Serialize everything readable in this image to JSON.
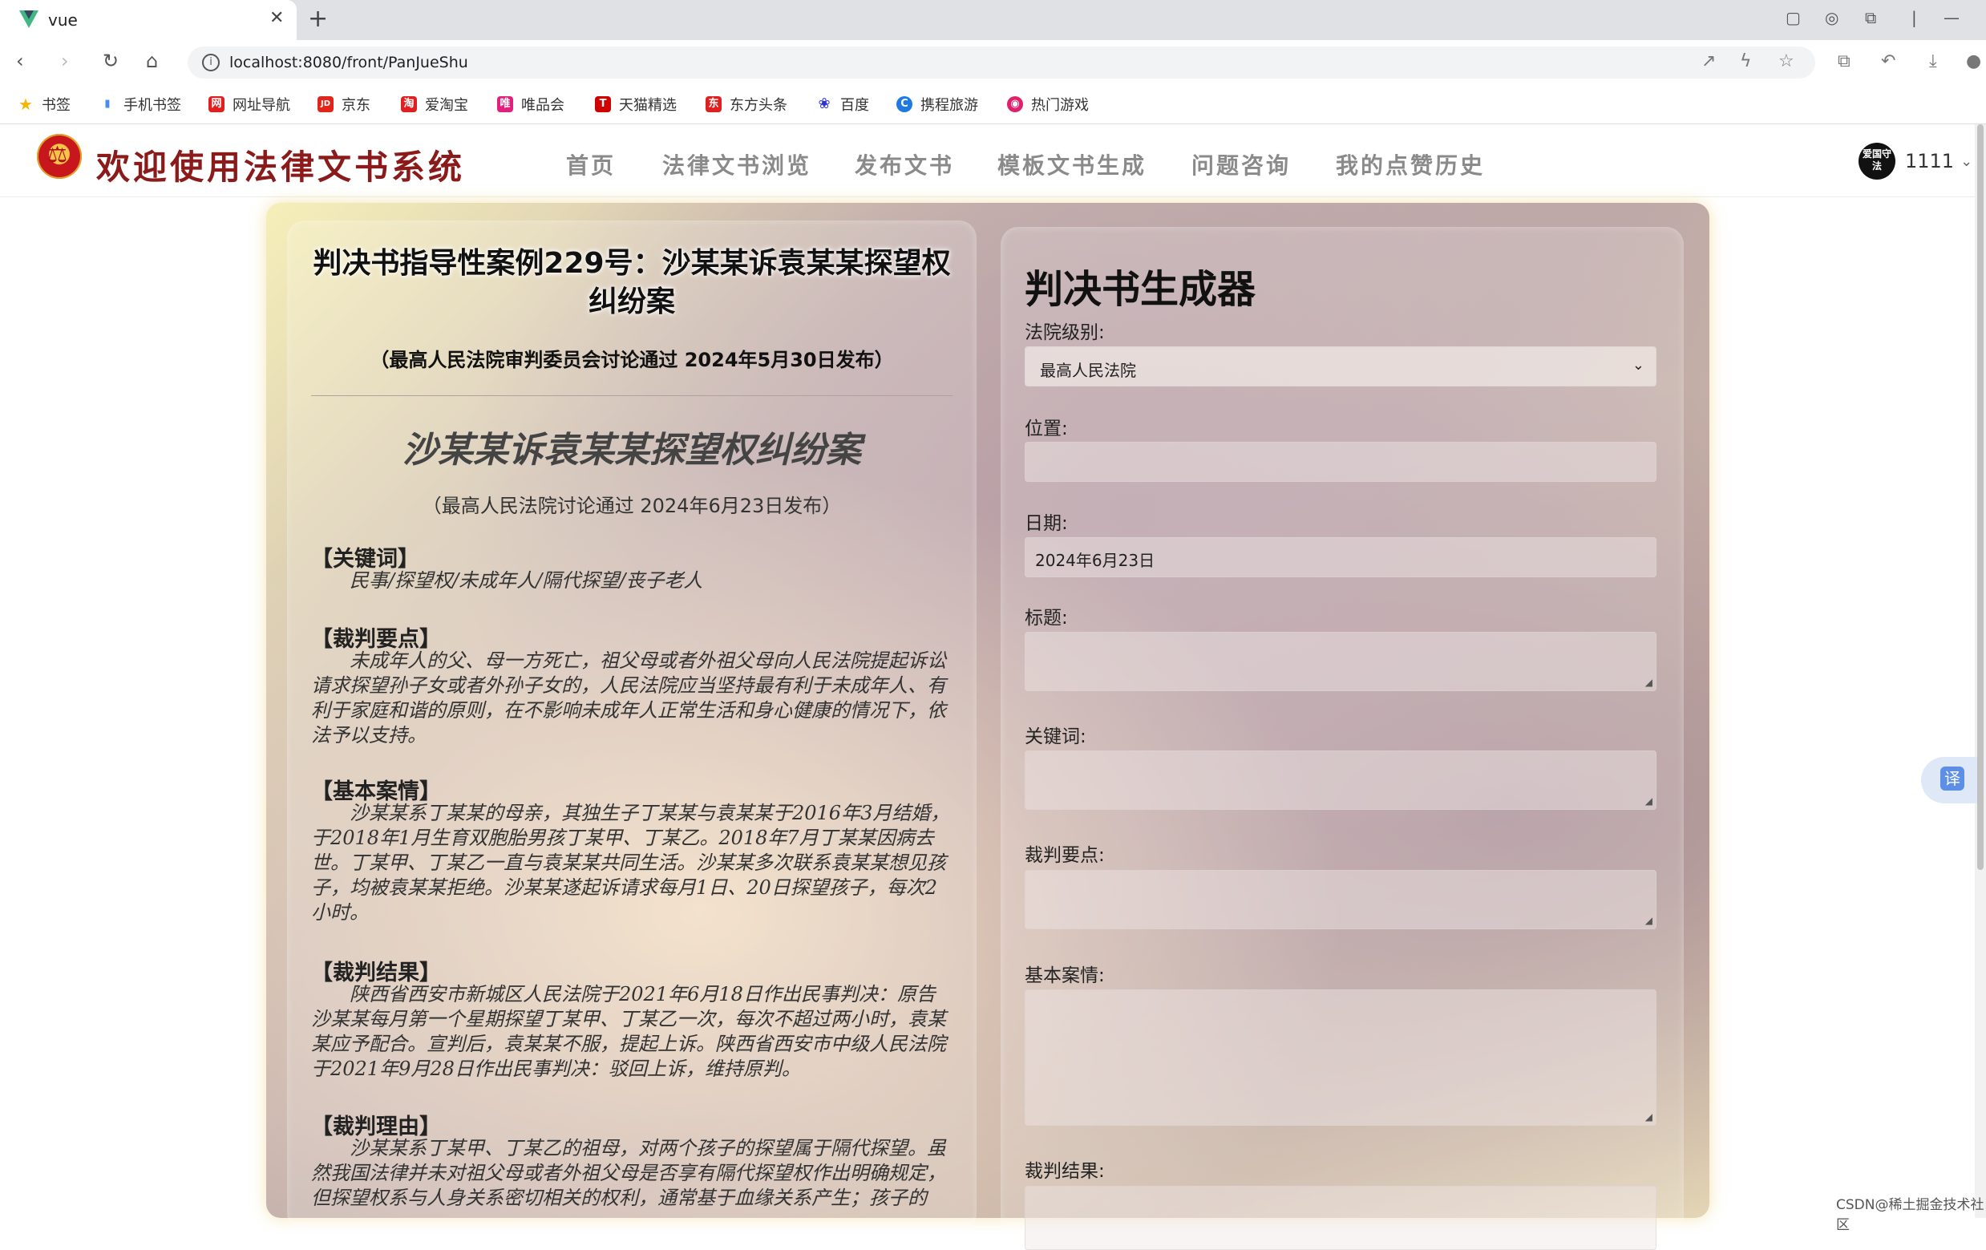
{
  "browser": {
    "tab_title": "vue",
    "url": "localhost:8080/front/PanJueShu",
    "bookmarks": [
      {
        "label": "书签",
        "color": "#f5b400",
        "glyph": "★"
      },
      {
        "label": "手机书签",
        "color": "#4a8af4",
        "glyph": "▮"
      },
      {
        "label": "网址导航",
        "color": "#e02020",
        "glyph": "网"
      },
      {
        "label": "京东",
        "color": "#e1251b",
        "glyph": "JD"
      },
      {
        "label": "爱淘宝",
        "color": "#e02020",
        "glyph": "淘"
      },
      {
        "label": "唯品会",
        "color": "#e0207a",
        "glyph": "唯"
      },
      {
        "label": "天猫精选",
        "color": "#d00000",
        "glyph": "T"
      },
      {
        "label": "东方头条",
        "color": "#e02020",
        "glyph": "东"
      },
      {
        "label": "百度",
        "color": "#2932e1",
        "glyph": "❀"
      },
      {
        "label": "携程旅游",
        "color": "#1f7ae0",
        "glyph": "C"
      },
      {
        "label": "热门游戏",
        "color": "#e0206a",
        "glyph": "◉"
      }
    ]
  },
  "site": {
    "title": "欢迎使用法律文书系统",
    "nav": [
      "首页",
      "法律文书浏览",
      "发布文书",
      "模板文书生成",
      "问题咨询",
      "我的点赞历史"
    ],
    "avatar_text": "爱国守法",
    "username": "1111"
  },
  "case": {
    "title": "判决书指导性案例229号：沙某某诉袁某某探望权纠纷案",
    "subtitle": "（最高人民法院审判委员会讨论通过 2024年5月30日发布）",
    "heading": "沙某某诉袁某某探望权纠纷案",
    "published": "（最高人民法院讨论通过 2024年6月23日发布）",
    "sections": [
      {
        "title": "【关键词】",
        "text": "民事/探望权/未成年人/隔代探望/丧子老人"
      },
      {
        "title": "【裁判要点】",
        "text": "未成年人的父、母一方死亡，祖父母或者外祖父母向人民法院提起诉讼请求探望孙子女或者外孙子女的，人民法院应当坚持最有利于未成年人、有利于家庭和谐的原则，在不影响未成年人正常生活和身心健康的情况下，依法予以支持。"
      },
      {
        "title": "【基本案情】",
        "text": "沙某某系丁某某的母亲，其独生子丁某某与袁某某于2016年3月结婚，于2018年1月生育双胞胎男孩丁某甲、丁某乙。2018年7月丁某某因病去世。丁某甲、丁某乙一直与袁某某共同生活。沙某某多次联系袁某某想见孩子，均被袁某某拒绝。沙某某遂起诉请求每月1日、20日探望孩子，每次2小时。"
      },
      {
        "title": "【裁判结果】",
        "text": "陕西省西安市新城区人民法院于2021年6月18日作出民事判决：原告沙某某每月第一个星期探望丁某甲、丁某乙一次，每次不超过两小时，袁某某应予配合。宣判后，袁某某不服，提起上诉。陕西省西安市中级人民法院于2021年9月28日作出民事判决：驳回上诉，维持原判。"
      },
      {
        "title": "【裁判理由】",
        "text": "沙某某系丁某甲、丁某乙的祖母，对两个孩子的探望属于隔代探望。虽然我国法律并未对祖父母或者外祖父母是否享有隔代探望权作出明确规定，但探望权系与人身关系密切相关的权利，通常基于血缘关系产生；孩子的"
      }
    ]
  },
  "generator": {
    "title": "判决书生成器",
    "court_level_label": "法院级别:",
    "court_level_value": "最高人民法院",
    "location_label": "位置:",
    "location_value": "",
    "date_label": "日期:",
    "date_value": "2024年6月23日",
    "title_label": "标题:",
    "keywords_label": "关键词:",
    "points_label": "裁判要点:",
    "facts_label": "基本案情:",
    "result_label": "裁判结果:"
  },
  "overlay": {
    "translate_glyph": "译",
    "watermark": "CSDN@稀土掘金技术社区"
  }
}
